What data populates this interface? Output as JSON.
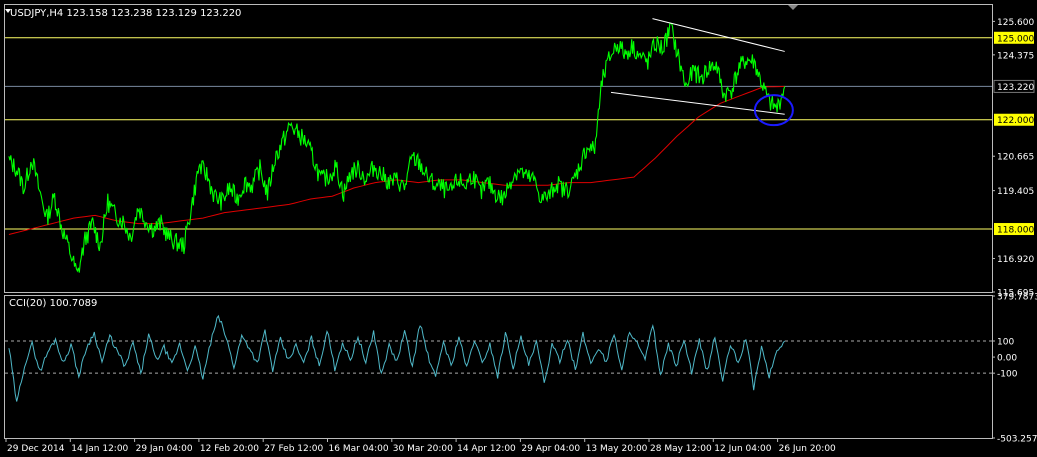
{
  "chart_data": [
    {
      "type": "line",
      "header": "USDJPY,H4  123.158 123.238 123.129 123.220",
      "price_axis": {
        "min": 115.695,
        "max": 126.2,
        "ticks": [
          "125.600",
          "124.375",
          "120.665",
          "119.405",
          "116.920",
          "115.695"
        ],
        "ticks_values": [
          125.6,
          124.375,
          120.665,
          119.405,
          116.92,
          115.695
        ]
      },
      "levels": [
        {
          "value": 125.0,
          "label": "125.000",
          "color": "#ffff66"
        },
        {
          "value": 122.0,
          "label": "122.000",
          "color": "#ffff66"
        },
        {
          "value": 118.0,
          "label": "118.000",
          "color": "#ffff66"
        }
      ],
      "current_price": {
        "value": 123.22,
        "label": "123.220",
        "color": "#7a8aa0"
      },
      "price_series": {
        "color": "#00ff00",
        "values": [
          120.5,
          120.2,
          119.5,
          120.6,
          119.4,
          118.4,
          119.2,
          118.0,
          117.2,
          116.3,
          117.6,
          118.2,
          117.4,
          119.0,
          118.5,
          118.3,
          117.7,
          118.8,
          118.3,
          118.0,
          118.2,
          117.7,
          117.5,
          117.4,
          118.8,
          120.3,
          120.0,
          119.2,
          119.0,
          119.5,
          119.1,
          119.7,
          119.6,
          120.2,
          119.3,
          120.6,
          121.2,
          121.8,
          121.5,
          121.2,
          120.6,
          119.8,
          119.9,
          120.3,
          119.3,
          120.1,
          120.2,
          119.8,
          120.3,
          120.0,
          119.7,
          119.8,
          119.5,
          120.6,
          120.4,
          119.9,
          119.6,
          119.5,
          119.3,
          119.8,
          119.6,
          120.0,
          119.3,
          119.7,
          119.3,
          119.1,
          119.8,
          120.2,
          119.9,
          119.8,
          119.1,
          119.2,
          119.7,
          119.4,
          119.6,
          120.3,
          121.0,
          120.9,
          123.4,
          124.3,
          124.8,
          124.4,
          124.7,
          124.3,
          124.1,
          124.8,
          124.6,
          125.4,
          124.3,
          123.2,
          123.8,
          123.5,
          123.9,
          124.0,
          122.9,
          123.1,
          123.9,
          124.2,
          124.1,
          123.3,
          122.6,
          122.4,
          123.22
        ],
        "x_start": 0.004,
        "x_end": 0.79
      },
      "moving_average": {
        "color": "#e00000",
        "values": [
          117.8,
          118.0,
          118.2,
          118.4,
          118.5,
          118.3,
          118.2,
          118.2,
          118.3,
          118.4,
          118.6,
          118.7,
          118.8,
          118.9,
          119.1,
          119.2,
          119.5,
          119.7,
          119.8,
          119.7,
          119.8,
          119.8,
          119.7,
          119.6,
          119.6,
          119.6,
          119.7,
          119.7,
          119.8,
          119.9,
          120.6,
          121.4,
          122.1,
          122.6,
          122.9,
          123.2,
          123.22
        ],
        "x_start": 0.004,
        "x_end": 0.79
      },
      "trendlines": [
        {
          "color": "#ffffff",
          "from": [
            0.656,
            125.7
          ],
          "to": [
            0.79,
            124.5
          ]
        },
        {
          "color": "#ffffff",
          "from": [
            0.614,
            123.0
          ],
          "to": [
            0.79,
            122.2
          ]
        }
      ],
      "annotation_circle": {
        "color": "#1a1aff",
        "x": 0.779,
        "y": 122.35
      }
    },
    {
      "type": "line",
      "header": "CCI(20) 100.7089",
      "cci_axis": {
        "min": -503.2579,
        "max": 379.7873,
        "ticks": [
          "379.7873",
          "100",
          "0.00",
          "-100",
          "-503.2579"
        ],
        "ticks_values": [
          379.7873,
          100,
          0,
          -100,
          -503.2579
        ]
      },
      "dashed_levels": [
        100,
        -100
      ],
      "cci_series": {
        "color": "#4fb8c8",
        "values": [
          60,
          -290,
          -50,
          80,
          -90,
          30,
          110,
          -40,
          80,
          -120,
          60,
          150,
          -30,
          130,
          30,
          -60,
          90,
          -110,
          140,
          -20,
          60,
          -50,
          80,
          -80,
          60,
          -130,
          90,
          260,
          120,
          -60,
          130,
          60,
          -40,
          160,
          -80,
          110,
          -20,
          70,
          -40,
          120,
          -60,
          170,
          -70,
          90,
          -20,
          130,
          -40,
          160,
          -110,
          70,
          -30,
          160,
          -60,
          210,
          10,
          -130,
          100,
          -60,
          130,
          -70,
          110,
          -40,
          80,
          -120,
          150,
          -60,
          120,
          -50,
          90,
          -160,
          70,
          -20,
          120,
          -80,
          140,
          -40,
          60,
          -30,
          150,
          -90,
          170,
          80,
          -20,
          200,
          -120,
          80,
          -60,
          110,
          -100,
          100,
          -90,
          130,
          -150,
          80,
          -40,
          120,
          -190,
          60,
          -120,
          40,
          100.7089
        ],
        "x_start": 0.004,
        "x_end": 0.79
      }
    }
  ],
  "x_axis": {
    "labels": [
      "29 Dec 2014",
      "14 Jan 12:00",
      "29 Jan 04:00",
      "12 Feb 20:00",
      "27 Feb 12:00",
      "16 Mar 04:00",
      "30 Mar 20:00",
      "14 Apr 12:00",
      "29 Apr 04:00",
      "13 May 20:00",
      "28 May 12:00",
      "12 Jun 04:00",
      "26 Jun 20:00"
    ]
  }
}
